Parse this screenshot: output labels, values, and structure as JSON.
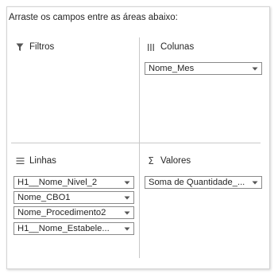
{
  "instructions": "Arraste os campos entre as áreas abaixo:",
  "areas": {
    "filtros": {
      "title": "Filtros",
      "icon": "filter-icon",
      "fields": []
    },
    "colunas": {
      "title": "Colunas",
      "icon": "columns-icon",
      "fields": [
        "Nome_Mes"
      ]
    },
    "linhas": {
      "title": "Linhas",
      "icon": "rows-icon",
      "fields": [
        "H1__Nome_Nivel_2",
        "Nome_CBO1",
        "Nome_Procedimento2",
        "H1__Nome_Estabele..."
      ]
    },
    "valores": {
      "title": "Valores",
      "icon": "sigma-icon",
      "fields": [
        "Soma de Quantidade_..."
      ]
    }
  },
  "colors": {
    "border": "#8a8a8a",
    "divider": "#c8c8c8",
    "text": "#262626"
  }
}
